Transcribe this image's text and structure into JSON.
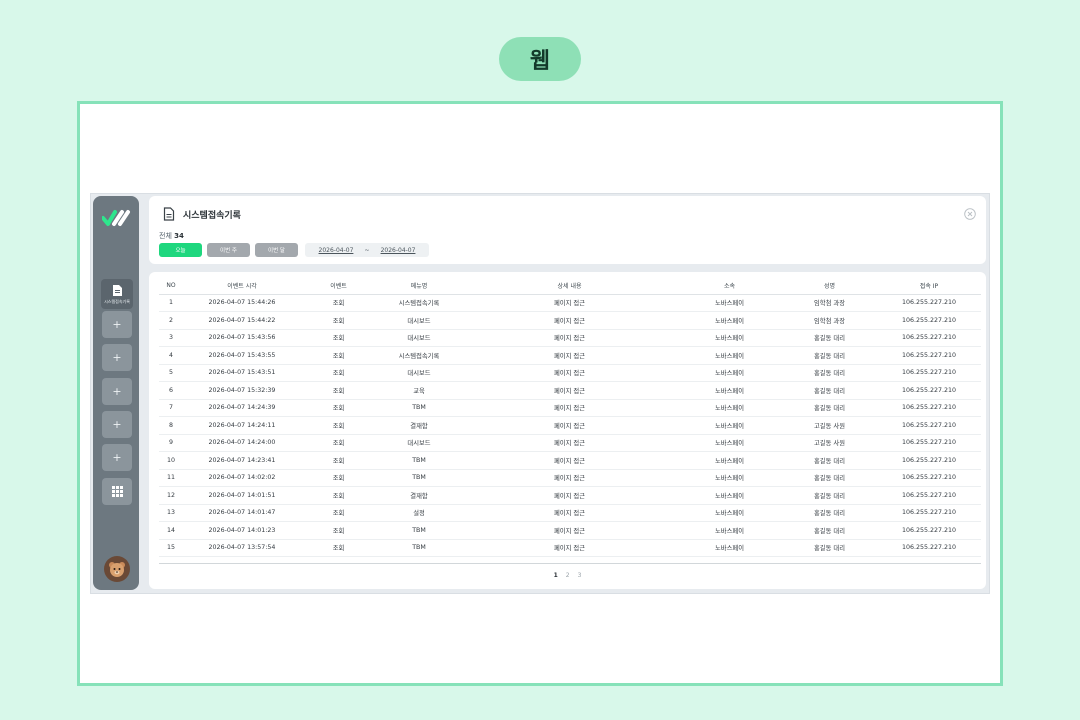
{
  "badge": "웹",
  "sidebar": {
    "active_label": "시스템접속기록",
    "items": [
      "+",
      "+",
      "+",
      "+",
      "+"
    ]
  },
  "header": {
    "title": "시스템접속기록",
    "total_label": "전체",
    "total_count": "34",
    "filters": [
      {
        "label": "오늘",
        "color": "#1ed77e"
      },
      {
        "label": "이번 주",
        "color": "#a3a8ad"
      },
      {
        "label": "이번 달",
        "color": "#a3a8ad"
      }
    ],
    "date_from": "2026-04-07",
    "date_sep": "~",
    "date_to": "2026-04-07"
  },
  "table": {
    "columns": [
      "NO",
      "이벤트 시각",
      "이벤트",
      "메뉴명",
      "상세 내용",
      "소속",
      "성명",
      "접속 IP"
    ],
    "rows": [
      [
        "1",
        "2026-04-07 15:44:26",
        "조회",
        "시스템접속기록",
        "페이지 접근",
        "노바스페이",
        "임학첨 과장",
        "106.255.227.210"
      ],
      [
        "2",
        "2026-04-07 15:44:22",
        "조회",
        "대시보드",
        "페이지 접근",
        "노바스페이",
        "임학첨 과장",
        "106.255.227.210"
      ],
      [
        "3",
        "2026-04-07 15:43:56",
        "조회",
        "대시보드",
        "페이지 접근",
        "노바스페이",
        "홍길동 대리",
        "106.255.227.210"
      ],
      [
        "4",
        "2026-04-07 15:43:55",
        "조회",
        "시스템접속기록",
        "페이지 접근",
        "노바스페이",
        "홍길동 대리",
        "106.255.227.210"
      ],
      [
        "5",
        "2026-04-07 15:43:51",
        "조회",
        "대시보드",
        "페이지 접근",
        "노바스페이",
        "홍길동 대리",
        "106.255.227.210"
      ],
      [
        "6",
        "2026-04-07 15:32:39",
        "조회",
        "교육",
        "페이지 접근",
        "노바스페이",
        "홍길동 대리",
        "106.255.227.210"
      ],
      [
        "7",
        "2026-04-07 14:24:39",
        "조회",
        "TBM",
        "페이지 접근",
        "노바스페이",
        "홍길동 대리",
        "106.255.227.210"
      ],
      [
        "8",
        "2026-04-07 14:24:11",
        "조회",
        "결재함",
        "페이지 접근",
        "노바스페이",
        "고길동 사원",
        "106.255.227.210"
      ],
      [
        "9",
        "2026-04-07 14:24:00",
        "조회",
        "대시보드",
        "페이지 접근",
        "노바스페이",
        "고길동 사원",
        "106.255.227.210"
      ],
      [
        "10",
        "2026-04-07 14:23:41",
        "조회",
        "TBM",
        "페이지 접근",
        "노바스페이",
        "홍길동 대리",
        "106.255.227.210"
      ],
      [
        "11",
        "2026-04-07 14:02:02",
        "조회",
        "TBM",
        "페이지 접근",
        "노바스페이",
        "홍길동 대리",
        "106.255.227.210"
      ],
      [
        "12",
        "2026-04-07 14:01:51",
        "조회",
        "결재함",
        "페이지 접근",
        "노바스페이",
        "홍길동 대리",
        "106.255.227.210"
      ],
      [
        "13",
        "2026-04-07 14:01:47",
        "조회",
        "설정",
        "페이지 접근",
        "노바스페이",
        "홍길동 대리",
        "106.255.227.210"
      ],
      [
        "14",
        "2026-04-07 14:01:23",
        "조회",
        "TBM",
        "페이지 접근",
        "노바스페이",
        "홍길동 대리",
        "106.255.227.210"
      ],
      [
        "15",
        "2026-04-07 13:57:54",
        "조회",
        "TBM",
        "페이지 접근",
        "노바스페이",
        "홍길동 대리",
        "106.255.227.210"
      ]
    ]
  },
  "pagination": [
    "1",
    "2",
    "3"
  ],
  "colors": {
    "accent": "#1ed77e",
    "background": "#d8f8ea",
    "frame": "#86e2b9",
    "sidebar": "#6d7880"
  }
}
